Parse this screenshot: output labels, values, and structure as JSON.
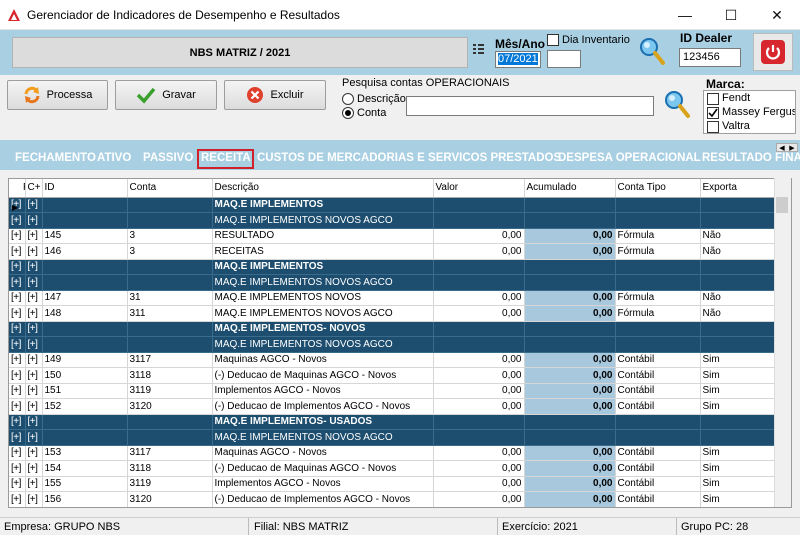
{
  "window": {
    "title": "Gerenciador de Indicadores de Desempenho e Resultados",
    "minimize": "—",
    "maximize": "☐",
    "close": "✕"
  },
  "header": {
    "company": "NBS MATRIZ / 2021",
    "mes_ano_label": "Mês/Ano",
    "mes_ano_value": "07/2021",
    "dia_inventario_label": "Dia Inventario",
    "id_dealer_label": "ID Dealer",
    "id_dealer_value": "123456"
  },
  "toolbar": {
    "processa": "Processa",
    "gravar": "Gravar",
    "excluir": "Excluir",
    "search_label": "Pesquisa contas OPERACIONAIS",
    "radio_descricao": "Descrição",
    "radio_conta": "Conta",
    "marca_label": "Marca:",
    "marcas": [
      {
        "label": "Fendt",
        "checked": false
      },
      {
        "label": "Massey Ferguson",
        "checked": true
      },
      {
        "label": "Valtra",
        "checked": false
      }
    ]
  },
  "tabs": [
    "FECHAMENTO",
    "ATIVO",
    "PASSIVO",
    "RECEITA",
    "CUSTOS DE MERCADORIAS E SERVICOS PRESTADOS",
    "DESPESA OPERACIONAL",
    "RESULTADO FINA"
  ],
  "active_tab": "RECEITA",
  "grid": {
    "columns": [
      "P+",
      "C+",
      "ID",
      "Conta",
      "Descrição",
      "Valor",
      "Acumulado",
      "Conta Tipo",
      "Exporta"
    ],
    "rows": [
      {
        "type": "group",
        "p": "[+]",
        "c": "[+]",
        "desc": "MAQ.E IMPLEMENTOS"
      },
      {
        "type": "sub",
        "p": "[+]",
        "c": "[+]",
        "desc": "MAQ.E IMPLEMENTOS NOVOS AGCO"
      },
      {
        "type": "data",
        "p": "[+]",
        "c": "[+]",
        "id": "145",
        "conta": "3",
        "desc": "RESULTADO",
        "valor": "0,00",
        "acum": "0,00",
        "tipo": "Fórmula",
        "exporta": "Não"
      },
      {
        "type": "data",
        "p": "[+]",
        "c": "[+]",
        "id": "146",
        "conta": "3",
        "desc": "RECEITAS",
        "valor": "0,00",
        "acum": "0,00",
        "tipo": "Fórmula",
        "exporta": "Não"
      },
      {
        "type": "group",
        "p": "[+]",
        "c": "[+]",
        "desc": "MAQ.E IMPLEMENTOS"
      },
      {
        "type": "sub",
        "p": "[+]",
        "c": "[+]",
        "desc": "MAQ.E IMPLEMENTOS NOVOS AGCO"
      },
      {
        "type": "data",
        "p": "[+]",
        "c": "[+]",
        "id": "147",
        "conta": "31",
        "desc": "MAQ.E IMPLEMENTOS NOVOS",
        "valor": "0,00",
        "acum": "0,00",
        "tipo": "Fórmula",
        "exporta": "Não"
      },
      {
        "type": "data",
        "p": "[+]",
        "c": "[+]",
        "id": "148",
        "conta": "311",
        "desc": "MAQ.E IMPLEMENTOS NOVOS AGCO",
        "valor": "0,00",
        "acum": "0,00",
        "tipo": "Fórmula",
        "exporta": "Não"
      },
      {
        "type": "group",
        "p": "[+]",
        "c": "[+]",
        "desc": "MAQ.E IMPLEMENTOS- NOVOS"
      },
      {
        "type": "sub",
        "p": "[+]",
        "c": "[+]",
        "desc": "MAQ.E IMPLEMENTOS NOVOS AGCO"
      },
      {
        "type": "data",
        "p": "[+]",
        "c": "[+]",
        "id": "149",
        "conta": "3117",
        "desc": "Maquinas AGCO - Novos",
        "valor": "0,00",
        "acum": "0,00",
        "tipo": "Contábil",
        "exporta": "Sim"
      },
      {
        "type": "data",
        "p": "[+]",
        "c": "[+]",
        "id": "150",
        "conta": "3118",
        "desc": "(-) Deducao de Maquinas AGCO - Novos",
        "valor": "0,00",
        "acum": "0,00",
        "tipo": "Contábil",
        "exporta": "Sim"
      },
      {
        "type": "data",
        "p": "[+]",
        "c": "[+]",
        "id": "151",
        "conta": "3119",
        "desc": "Implementos AGCO - Novos",
        "valor": "0,00",
        "acum": "0,00",
        "tipo": "Contábil",
        "exporta": "Sim"
      },
      {
        "type": "data",
        "p": "[+]",
        "c": "[+]",
        "id": "152",
        "conta": "3120",
        "desc": "(-) Deducao de Implementos AGCO - Novos",
        "valor": "0,00",
        "acum": "0,00",
        "tipo": "Contábil",
        "exporta": "Sim"
      },
      {
        "type": "group",
        "p": "[+]",
        "c": "[+]",
        "desc": "MAQ.E IMPLEMENTOS- USADOS"
      },
      {
        "type": "sub",
        "p": "[+]",
        "c": "[+]",
        "desc": "MAQ.E IMPLEMENTOS NOVOS AGCO"
      },
      {
        "type": "data",
        "p": "[+]",
        "c": "[+]",
        "id": "153",
        "conta": "3117",
        "desc": "Maquinas AGCO - Novos",
        "valor": "0,00",
        "acum": "0,00",
        "tipo": "Contábil",
        "exporta": "Sim"
      },
      {
        "type": "data",
        "p": "[+]",
        "c": "[+]",
        "id": "154",
        "conta": "3118",
        "desc": "(-) Deducao de Maquinas AGCO - Novos",
        "valor": "0,00",
        "acum": "0,00",
        "tipo": "Contábil",
        "exporta": "Sim"
      },
      {
        "type": "data",
        "p": "[+]",
        "c": "[+]",
        "id": "155",
        "conta": "3119",
        "desc": "Implementos AGCO - Novos",
        "valor": "0,00",
        "acum": "0,00",
        "tipo": "Contábil",
        "exporta": "Sim"
      },
      {
        "type": "data",
        "p": "[+]",
        "c": "[+]",
        "id": "156",
        "conta": "3120",
        "desc": "(-) Deducao de Implementos AGCO - Novos",
        "valor": "0,00",
        "acum": "0,00",
        "tipo": "Contábil",
        "exporta": "Sim"
      }
    ]
  },
  "status": {
    "empresa": "Empresa: GRUPO NBS",
    "filial": "Filial: NBS MATRIZ",
    "exercicio": "Exercício: 2021",
    "grupo_pc": "Grupo PC: 28"
  },
  "colors": {
    "panel_blue": "#a9cfe3",
    "group_row": "#1d4e6f",
    "accumulated_cell": "#a8c8de",
    "active_tab_outline": "#d0202a"
  }
}
